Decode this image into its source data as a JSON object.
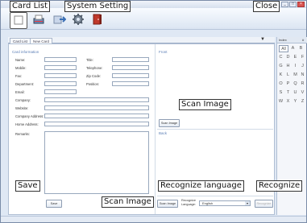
{
  "window": {
    "controls": {
      "minimize": "_",
      "maximize": "□",
      "close": "×"
    }
  },
  "toolbar": {
    "buttons": [
      {
        "name": "card-list",
        "icon": "card-list-icon"
      },
      {
        "name": "scan",
        "icon": "scanner-icon"
      },
      {
        "name": "export",
        "icon": "export-arrow-icon"
      },
      {
        "name": "system-setting",
        "icon": "gear-icon"
      },
      {
        "name": "exit",
        "icon": "exit-door-icon"
      }
    ]
  },
  "annotations": {
    "card_list": "Card List",
    "system_setting": "System Setting",
    "close": "Close",
    "scan_image_right": "Scan Image",
    "save": "Save",
    "scan_image_bottom": "Scan Image",
    "recognize_language": "Recognize language",
    "recognize": "Recognize"
  },
  "tabs": [
    {
      "label": "Card List"
    },
    {
      "label": "New Card"
    }
  ],
  "form": {
    "section_title": "Card information",
    "left_labels": [
      "Name:",
      "Mobile:",
      "Fax:",
      "Department:",
      "Email:",
      "Company:",
      "Website:",
      "Company Address:",
      "Home Address:",
      "Remarks:"
    ],
    "right_labels": [
      "Title:",
      "Telephone:",
      "Zip Code:",
      "Position:"
    ]
  },
  "front": {
    "section_title": "Front",
    "scan_button": "Scan Image"
  },
  "back": {
    "section_title": "Back"
  },
  "bottom": {
    "save_button": "Save",
    "scan_button": "Scan Image",
    "lang_label": "Recognize Language:",
    "lang_value": "English",
    "recognize_button": "Recognize"
  },
  "index": {
    "header_left": "Index",
    "header_right": "#",
    "letters": [
      "All",
      "A",
      "B",
      "C",
      "D",
      "E",
      "F",
      "G",
      "H",
      "I",
      "J",
      "K",
      "L",
      "M",
      "N",
      "O",
      "P",
      "Q",
      "R",
      "S",
      "T",
      "U",
      "V",
      "W",
      "X",
      "Y",
      "Z"
    ]
  }
}
